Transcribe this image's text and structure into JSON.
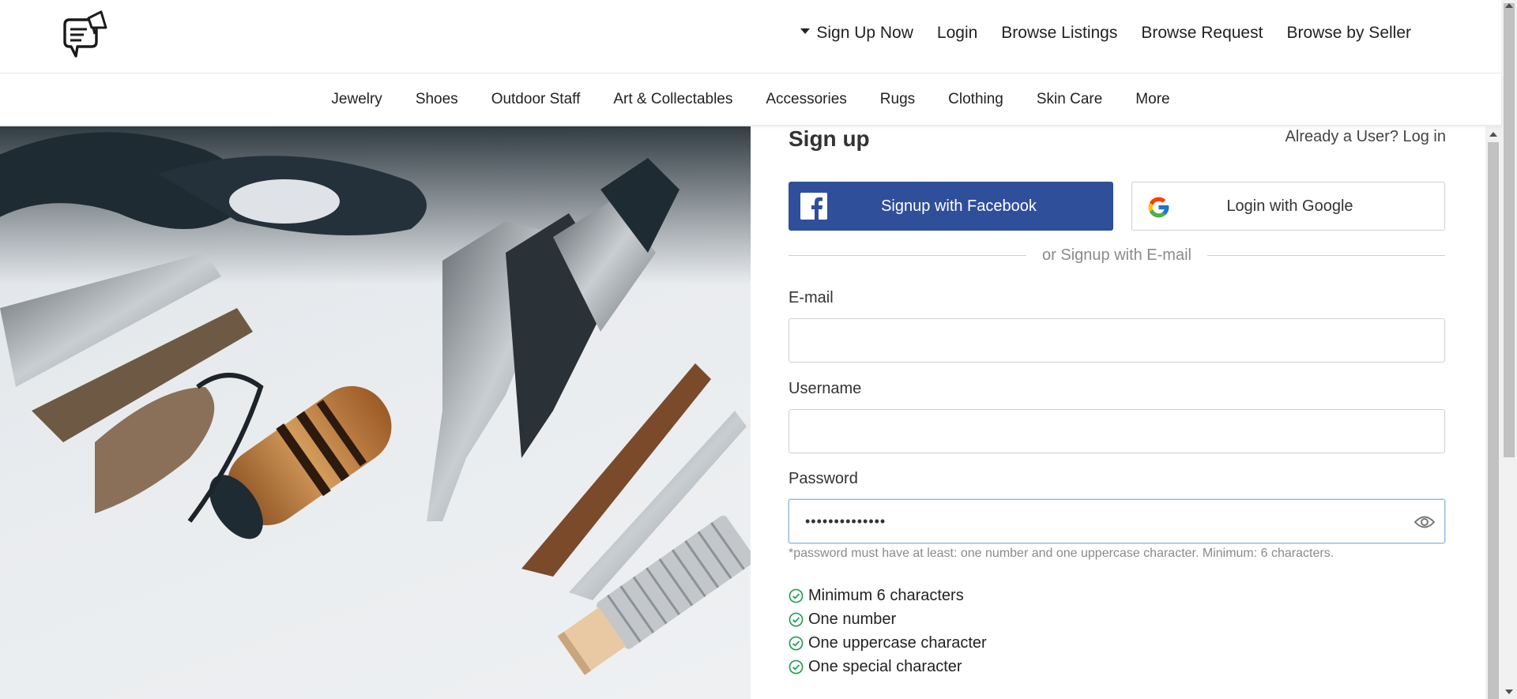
{
  "header": {
    "logo_icon": "chat-megaphone-icon",
    "nav": {
      "dropdown_caret_icon": "caret-down-icon",
      "signup": "Sign Up Now",
      "login": "Login",
      "browse_listings": "Browse Listings",
      "browse_request": "Browse Request",
      "browse_seller": "Browse by Seller"
    }
  },
  "categories": [
    "Jewelry",
    "Shoes",
    "Outdoor Staff",
    "Art & Collectables",
    "Accessories",
    "Rugs",
    "Clothing",
    "Skin Care",
    "More"
  ],
  "hero": {
    "image": "craft-tools-photo"
  },
  "signup": {
    "title": "Sign up",
    "already_user": "Already a User? Log in",
    "facebook": {
      "label": "Signup with Facebook",
      "icon": "facebook-icon",
      "color": "#2f4f9b"
    },
    "google": {
      "label": "Login with Google",
      "icon": "google-icon"
    },
    "divider": "or Signup with E-mail",
    "email": {
      "label": "E-mail",
      "value": ""
    },
    "username": {
      "label": "Username",
      "value": ""
    },
    "password": {
      "label": "Password",
      "value": "••••••••••••••",
      "toggle_icon": "eye-icon",
      "hint": "*password must have at least: one number and one uppercase character. Minimum: 6 characters."
    },
    "requirements": [
      {
        "text": "Minimum 6 characters",
        "met": true
      },
      {
        "text": "One number",
        "met": true
      },
      {
        "text": "One uppercase character",
        "met": true
      },
      {
        "text": "One special character",
        "met": true
      }
    ],
    "check_color": "#2a9d5c"
  }
}
